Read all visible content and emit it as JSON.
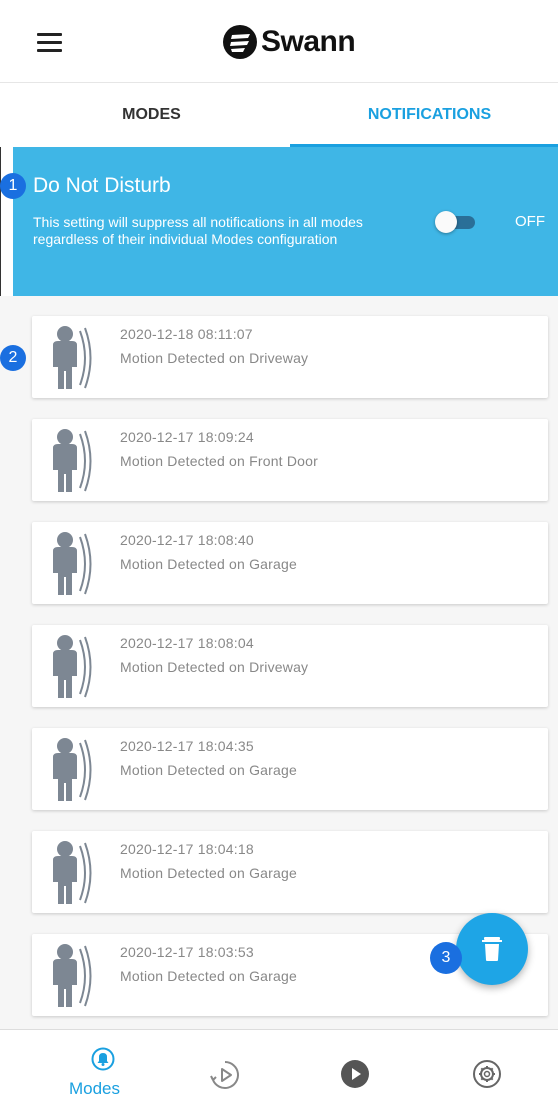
{
  "header": {
    "logo_text": "Swann",
    "menu_icon": "hamburger-menu-icon",
    "logo_icon": "swann-logo-icon"
  },
  "tabs": [
    {
      "label": "MODES",
      "active": false
    },
    {
      "label": "NOTIFICATIONS",
      "active": true
    }
  ],
  "dnd": {
    "title": "Do Not Disturb",
    "description": "This setting will suppress all notifications in all modes regardless of their individual Modes configuration",
    "toggle_state": "OFF",
    "enabled": false
  },
  "notifications": [
    {
      "timestamp": "2020-12-18 08:11:07",
      "message": "Motion Detected on Driveway",
      "icon": "motion-person-icon"
    },
    {
      "timestamp": "2020-12-17 18:09:24",
      "message": "Motion Detected on Front Door",
      "icon": "motion-person-icon"
    },
    {
      "timestamp": "2020-12-17 18:08:40",
      "message": "Motion Detected on Garage",
      "icon": "motion-person-icon"
    },
    {
      "timestamp": "2020-12-17 18:08:04",
      "message": "Motion Detected on Driveway",
      "icon": "motion-person-icon"
    },
    {
      "timestamp": "2020-12-17 18:04:35",
      "message": "Motion Detected on Garage",
      "icon": "motion-person-icon"
    },
    {
      "timestamp": "2020-12-17 18:04:18",
      "message": "Motion Detected on Garage",
      "icon": "motion-person-icon"
    },
    {
      "timestamp": "2020-12-17 18:03:53",
      "message": "Motion Detected on Garage",
      "icon": "motion-person-icon"
    }
  ],
  "badges": [
    "1",
    "2",
    "3"
  ],
  "fab": {
    "icon": "trash-icon"
  },
  "bottom_nav": [
    {
      "label": "Modes",
      "icon": "bell-icon",
      "active": true
    },
    {
      "label": "",
      "icon": "playback-icon",
      "active": false
    },
    {
      "label": "",
      "icon": "live-play-icon",
      "active": false
    },
    {
      "label": "",
      "icon": "settings-gear-icon",
      "active": false
    }
  ],
  "colors": {
    "accent": "#1aa0e0",
    "banner": "#3fb6e6",
    "badge": "#1a6fe0",
    "icon_gray": "#7d8793"
  }
}
